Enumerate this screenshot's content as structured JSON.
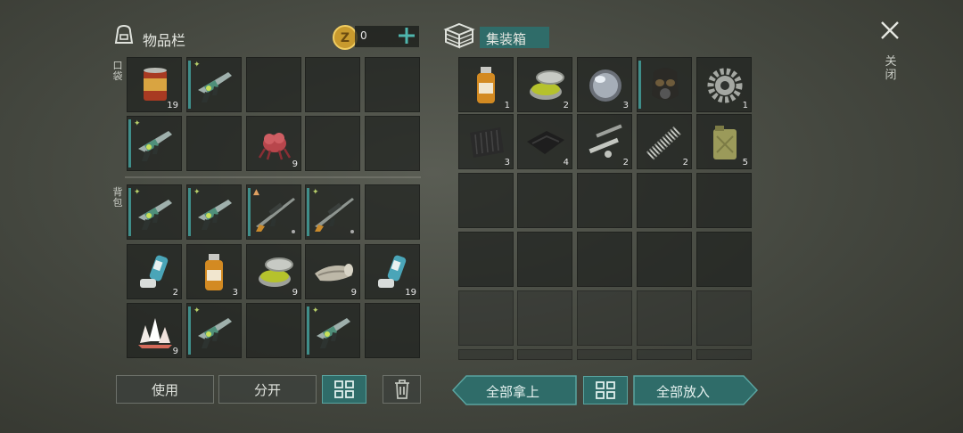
{
  "inventory": {
    "title": "物品栏",
    "coin_count": "0",
    "pocket_label": "口袋",
    "backpack_label": "背包",
    "pocket_slots": [
      {
        "icon": "canned-food-icon",
        "qty": "19"
      },
      {
        "icon": "blaster-rifle-icon",
        "qty": "",
        "bar": true,
        "badge": "mod"
      },
      {
        "icon": "",
        "qty": ""
      },
      {
        "icon": "",
        "qty": ""
      },
      {
        "icon": "",
        "qty": ""
      },
      {
        "icon": "blaster-rifle-icon",
        "qty": "",
        "bar": true,
        "badge": "mod"
      },
      {
        "icon": "",
        "qty": ""
      },
      {
        "icon": "red-creature-icon",
        "qty": "9"
      },
      {
        "icon": "",
        "qty": ""
      },
      {
        "icon": "",
        "qty": ""
      }
    ],
    "backpack_slots": [
      {
        "icon": "blaster-rifle-icon",
        "qty": "",
        "bar": true,
        "badge": "mod"
      },
      {
        "icon": "blaster-rifle-icon",
        "qty": "",
        "bar": true,
        "badge": "mod"
      },
      {
        "icon": "sniper-rifle-icon",
        "qty": "",
        "bar": true,
        "badge": "rank",
        "dot": true
      },
      {
        "icon": "sniper-rifle-icon",
        "qty": "",
        "bar": true,
        "badge": "mod",
        "dot": true
      },
      {
        "icon": "",
        "qty": ""
      },
      {
        "icon": "inhaler-icon",
        "qty": "2"
      },
      {
        "icon": "bottle-icon",
        "qty": "3"
      },
      {
        "icon": "ointment-tin-icon",
        "qty": "9"
      },
      {
        "icon": "bandage-roll-icon",
        "qty": "9"
      },
      {
        "icon": "inhaler-icon",
        "qty": "19"
      },
      {
        "icon": "crystal-icon",
        "qty": "9"
      },
      {
        "icon": "blaster-rifle-icon",
        "qty": "",
        "bar": true,
        "badge": "mod"
      },
      {
        "icon": "",
        "qty": ""
      },
      {
        "icon": "blaster-rifle-icon",
        "qty": "",
        "bar": true,
        "badge": "mod"
      },
      {
        "icon": "",
        "qty": ""
      }
    ]
  },
  "container": {
    "title": "集装箱",
    "slots_row1": [
      {
        "icon": "bottle-icon",
        "qty": "1"
      },
      {
        "icon": "ointment-tin-icon",
        "qty": "2"
      },
      {
        "icon": "lens-icon",
        "qty": "3"
      },
      {
        "icon": "gas-mask-icon",
        "qty": "",
        "bar": true
      },
      {
        "icon": "gear-icon",
        "qty": "1"
      }
    ],
    "slots_row2": [
      {
        "icon": "black-cloth-icon",
        "qty": "3"
      },
      {
        "icon": "leather-icon",
        "qty": "4"
      },
      {
        "icon": "metal-parts-icon",
        "qty": "2"
      },
      {
        "icon": "spring-icon",
        "qty": "2"
      },
      {
        "icon": "jerrycan-icon",
        "qty": "5"
      }
    ]
  },
  "buttons": {
    "use": "使用",
    "split": "分开",
    "take_all": "全部拿上",
    "put_all": "全部放入",
    "close": "关闭"
  },
  "colors": {
    "accent": "#2f6c69",
    "accent_border": "#5aa4a0",
    "bar": "#3f8e8a"
  }
}
